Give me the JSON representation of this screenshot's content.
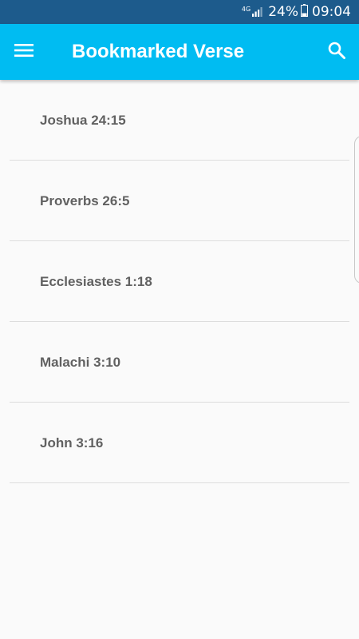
{
  "status_bar": {
    "network": "4G",
    "battery_percent": "24%",
    "time": "09:04"
  },
  "app_bar": {
    "title": "Bookmarked Verse",
    "background": "#00bcf2",
    "menu_icon": "hamburger-menu-icon",
    "search_icon": "search-icon"
  },
  "bookmarks": [
    {
      "reference": "Joshua 24:15"
    },
    {
      "reference": "Proverbs 26:5"
    },
    {
      "reference": "Ecclesiastes 1:18"
    },
    {
      "reference": "Malachi 3:10"
    },
    {
      "reference": "John 3:16"
    }
  ]
}
